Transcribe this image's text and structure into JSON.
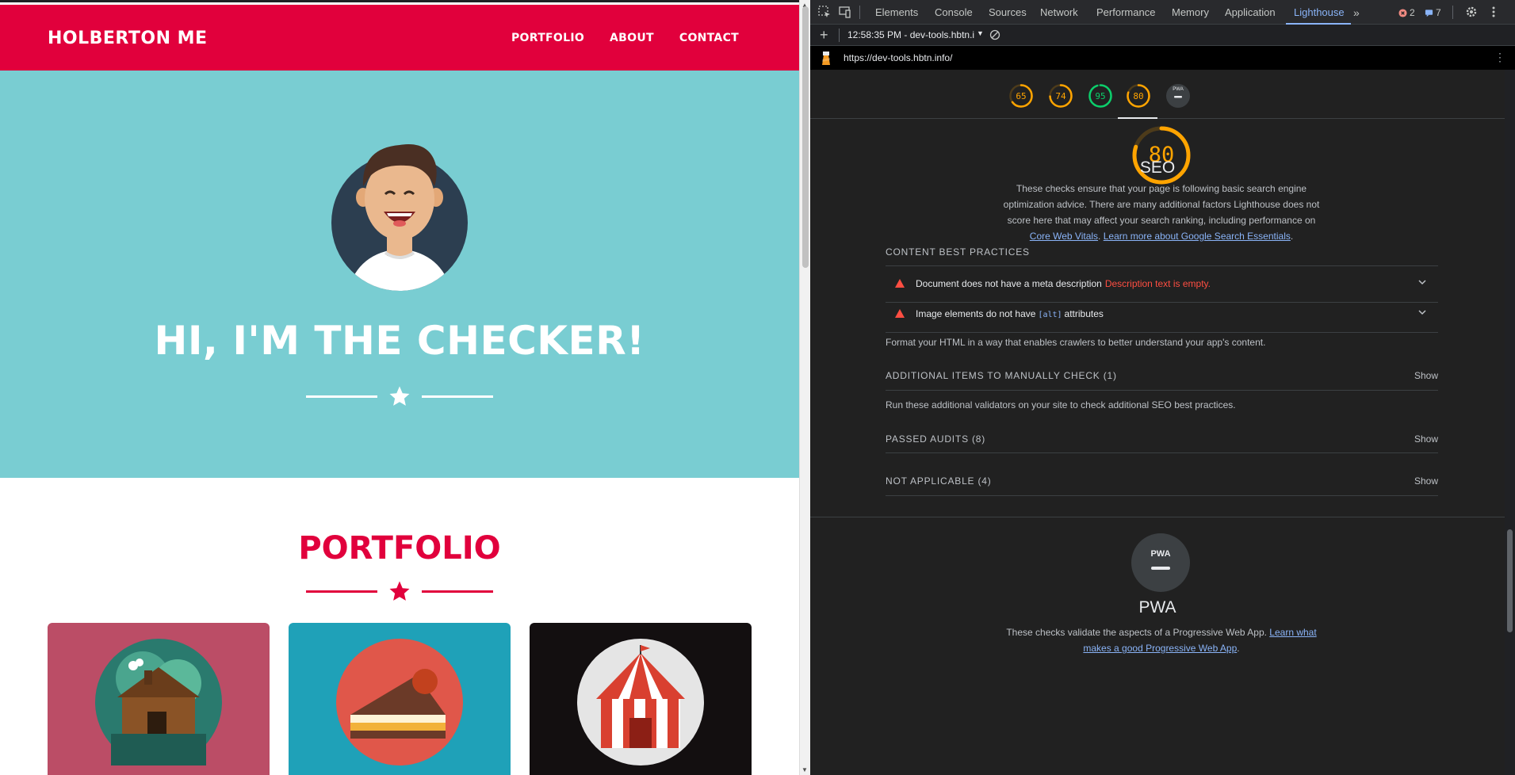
{
  "site": {
    "brand": "HOLBERTON ME",
    "nav": [
      "PORTFOLIO",
      "ABOUT",
      "CONTACT"
    ],
    "hero_title": "HI, I'M THE CHECKER!",
    "portfolio_title": "PORTFOLIO",
    "colors": {
      "brand": "#e1003c",
      "hero_bg": "#79cdd2"
    },
    "cards": [
      {
        "bg": "#bb4d66",
        "icon": "cabin-icon"
      },
      {
        "bg": "#1fa1b8",
        "icon": "cake-icon"
      },
      {
        "bg": "#130f10",
        "icon": "circus-tent-icon"
      }
    ]
  },
  "devtools": {
    "tabs": [
      "Elements",
      "Console",
      "Sources",
      "Network",
      "Performance",
      "Memory",
      "Application",
      "Lighthouse"
    ],
    "active_tab": "Lighthouse",
    "errors_count": "2",
    "messages_count": "7",
    "report_label": "12:58:35 PM - dev-tools.hbtn.i",
    "url": "https://dev-tools.hbtn.info/",
    "scores": [
      {
        "value": "65",
        "color": "#ffa400"
      },
      {
        "value": "74",
        "color": "#ffa400"
      },
      {
        "value": "95",
        "color": "#0cce6b"
      },
      {
        "value": "80",
        "color": "#ffa400"
      }
    ],
    "pwa_short": "PWA",
    "seo": {
      "score": "80",
      "title": "SEO",
      "desc_line1": "These checks ensure that your page is following basic search engine",
      "desc_line2": "optimization advice. There are many additional factors Lighthouse does not",
      "desc_line3": "score here that may affect your search ranking, including performance on",
      "link1": "Core Web Vitals",
      "link2": "Learn more about Google Search Essentials",
      "content_head": "CONTENT BEST PRACTICES",
      "audit1_text": "Document does not have a meta description",
      "audit1_warn": "Description text is empty.",
      "audit2_pre": "Image elements do not have",
      "audit2_code": "[alt]",
      "audit2_post": "attributes",
      "format_note": "Format your HTML in a way that enables crawlers to better understand your app's content.",
      "manual_head": "ADDITIONAL ITEMS TO MANUALLY CHECK (1)",
      "manual_note": "Run these additional validators on your site to check additional SEO best practices.",
      "passed_head": "PASSED AUDITS (8)",
      "na_head": "NOT APPLICABLE (4)",
      "show_label": "Show"
    },
    "pwa": {
      "badge": "PWA",
      "title": "PWA",
      "desc": "These checks validate the aspects of a Progressive Web App.",
      "link_a": "Learn what",
      "link_b": "makes a good Progressive Web App"
    }
  }
}
